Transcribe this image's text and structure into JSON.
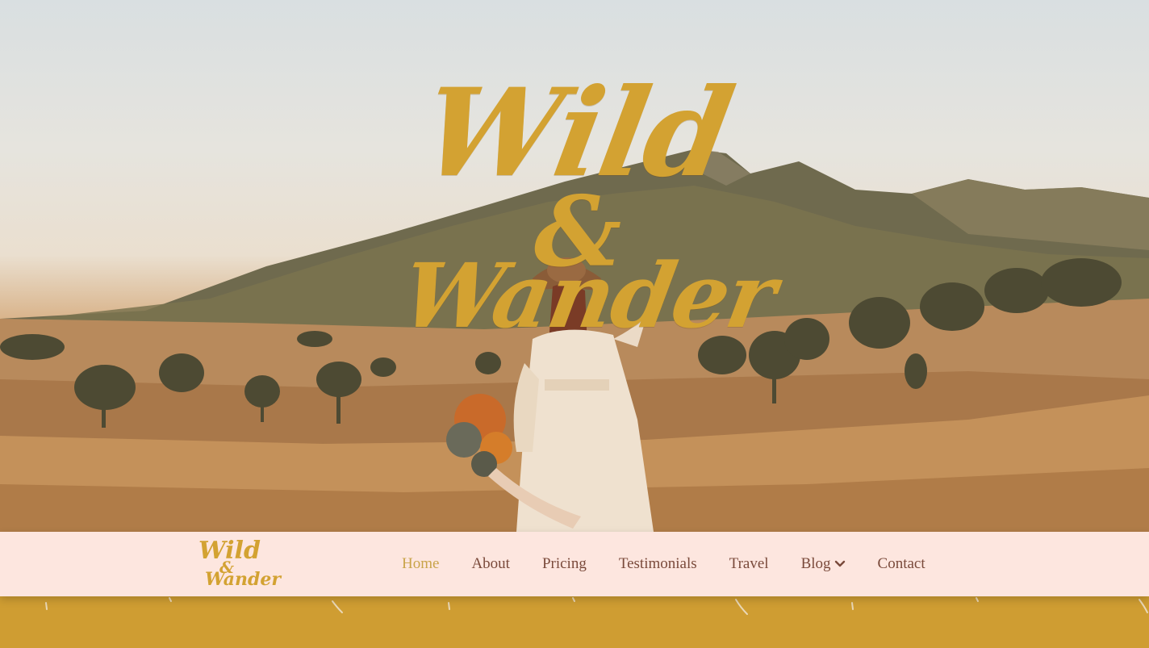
{
  "hero": {
    "title_line1": "Wild",
    "title_amp": "&",
    "title_line2": "Wander"
  },
  "logo": {
    "line1": "Wild",
    "amp": "&",
    "line2": "Wander"
  },
  "nav": {
    "items": [
      {
        "label": "Home",
        "active": true
      },
      {
        "label": "About"
      },
      {
        "label": "Pricing"
      },
      {
        "label": "Testimonials"
      },
      {
        "label": "Travel"
      },
      {
        "label": "Blog",
        "icon": "chevron-down-icon"
      },
      {
        "label": "Contact"
      }
    ]
  },
  "colors": {
    "brand_gold": "#d3a232",
    "nav_bg": "#fde6df",
    "nav_text": "#7a4a3b",
    "nav_active": "#c9a44a",
    "footer_band": "#cf9d32"
  }
}
